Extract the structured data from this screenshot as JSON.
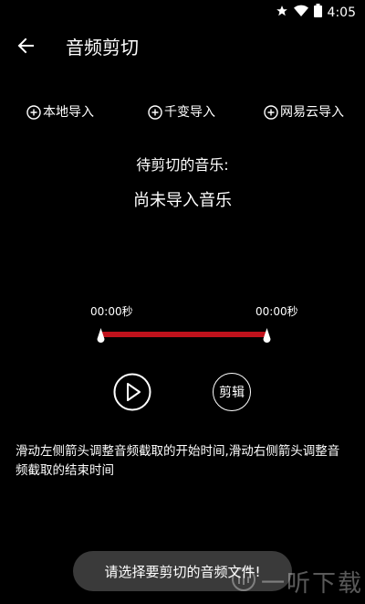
{
  "status_bar": {
    "time": "4:05",
    "icons": [
      "star-icon",
      "wifi-icon",
      "battery-icon"
    ]
  },
  "app_bar": {
    "title": "音频剪切",
    "back_icon": "arrow-back-icon"
  },
  "import_buttons": [
    {
      "label": "本地导入",
      "icon": "plus-circle-icon"
    },
    {
      "label": "千变导入",
      "icon": "plus-circle-icon"
    },
    {
      "label": "网易云导入",
      "icon": "plus-circle-icon"
    }
  ],
  "music": {
    "label": "待剪切的音乐:",
    "name": "尚未导入音乐"
  },
  "range": {
    "start_time": "00:00秒",
    "end_time": "00:00秒",
    "start_fraction": 0.0,
    "end_fraction": 1.0
  },
  "controls": {
    "play_icon": "play-circle-icon",
    "cut_label": "剪辑"
  },
  "instructions": "滑动左侧箭头调整音频截取的开始时间,滑动右侧箭头调整音频截取的结束时间",
  "toast": "请选择要剪切的音频文件!",
  "watermark": {
    "text": "一听下载"
  },
  "colors": {
    "background": "#000000",
    "accent": "#c0121c",
    "toast_bg": "#3a3a3a",
    "text": "#ffffff"
  }
}
